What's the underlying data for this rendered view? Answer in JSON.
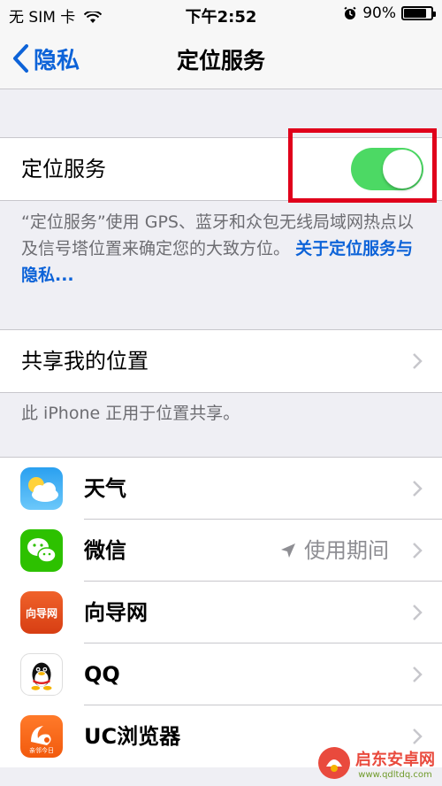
{
  "status_bar": {
    "carrier": "无 SIM 卡",
    "time": "下午2:52",
    "battery": "90%",
    "battery_fraction": 0.9
  },
  "nav": {
    "back_label": "隐私",
    "title": "定位服务"
  },
  "location_services": {
    "label": "定位服务",
    "enabled": true,
    "accent": "#4cd964",
    "footer_text": "“定位服务”使用 GPS、蓝牙和众包无线局域网热点以及信号塔位置来确定您的大致方位。",
    "footer_link": "关于定位服务与隐私..."
  },
  "share_location": {
    "label": "共享我的位置",
    "footer": "此 iPhone 正用于位置共享。"
  },
  "apps": [
    {
      "name": "天气",
      "icon": "weather-icon",
      "status": ""
    },
    {
      "name": "微信",
      "icon": "wechat-icon",
      "status": "使用期间",
      "status_icon": "location-arrow-icon"
    },
    {
      "name": "向导网",
      "icon": "xiangdao-icon",
      "status": "",
      "icon_text": "向导网"
    },
    {
      "name": "QQ",
      "icon": "qq-icon",
      "status": ""
    },
    {
      "name": "UC浏览器",
      "icon": "uc-browser-icon",
      "status": "",
      "icon_text": "亲邻今日"
    }
  ],
  "watermark": {
    "brand": "启东安卓网",
    "url": "www.qdltdq.com"
  }
}
